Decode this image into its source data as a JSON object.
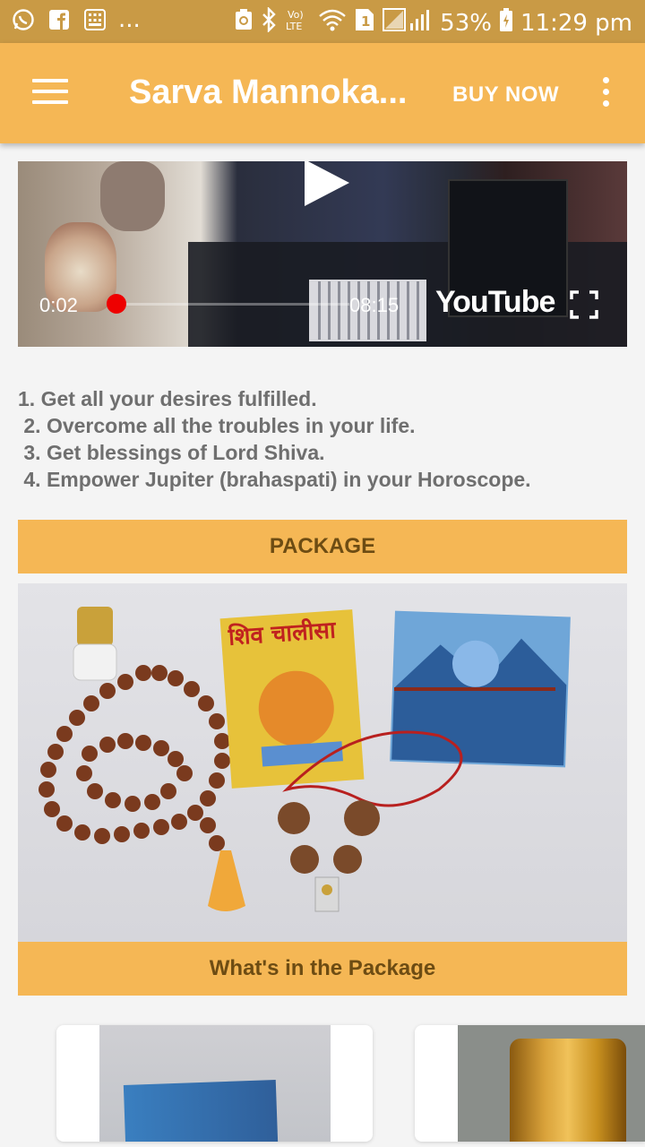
{
  "status_bar": {
    "time": "11:29 pm",
    "battery_percent": "53%",
    "sim_badge": "1",
    "more_notifications": "...",
    "icons": [
      "whatsapp-icon",
      "facebook-icon",
      "calculator-icon",
      "battery-saver-icon",
      "bluetooth-icon",
      "volte-icon",
      "wifi-icon",
      "sim-icon",
      "signal-icon",
      "battery-icon"
    ]
  },
  "app_bar": {
    "title": "Sarva Mannoka...",
    "buy_now": "BUY NOW"
  },
  "video": {
    "current_time": "0:02",
    "duration": "08:15",
    "brand": "YouTube",
    "progress_fraction": 0.004
  },
  "benefits": [
    "1. Get all your desires fulfilled.",
    " 2. Overcome all the troubles in your life.",
    " 3. Get blessings of Lord Shiva.",
    " 4. Empower Jupiter (brahaspati) in your Horoscope."
  ],
  "package_button": "PACKAGE",
  "package_photo": {
    "book_title": "शिव चालीसा"
  },
  "package_caption": "What's in the Package",
  "colors": {
    "status_bar": "#c99a45",
    "accent": "#f5b755",
    "accent_text": "#6d4c13",
    "body_text": "#6f6f6f"
  }
}
